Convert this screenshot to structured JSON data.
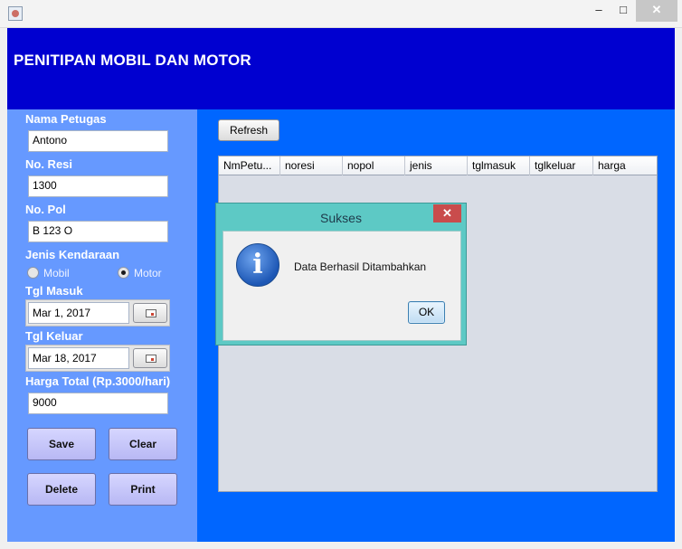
{
  "window": {
    "minimize": "–",
    "maximize": "□",
    "close": "✕"
  },
  "banner": {
    "title": "PENITIPAN MOBIL DAN MOTOR"
  },
  "form": {
    "nama_label": "Nama Petugas",
    "nama_value": "Antono",
    "resi_label": "No. Resi",
    "resi_value": "1300",
    "pol_label": "No. Pol",
    "pol_value": "B 123 O",
    "jenis_label": "Jenis Kendaraan",
    "radio_mobil": "Mobil",
    "radio_motor": "Motor",
    "selected_jenis": "Motor",
    "masuk_label": "Tgl Masuk",
    "masuk_value": "Mar 1, 2017",
    "keluar_label": "Tgl Keluar",
    "keluar_value": "Mar 18, 2017",
    "harga_label": "Harga Total (Rp.3000/hari)",
    "harga_value": "9000"
  },
  "buttons": {
    "save": "Save",
    "clear": "Clear",
    "delete": "Delete",
    "print": "Print",
    "refresh": "Refresh"
  },
  "table": {
    "columns": [
      "NmPetu...",
      "noresi",
      "nopol",
      "jenis",
      "tglmasuk",
      "tglkeluar",
      "harga"
    ],
    "rows": []
  },
  "dialog": {
    "title": "Sukses",
    "message": "Data Berhasil Ditambahkan",
    "ok": "OK",
    "close": "✕"
  },
  "colors": {
    "banner": "#0000d0",
    "form_panel": "#6699ff",
    "right_panel": "#0066ff",
    "dialog_frame": "#5dc9c5"
  },
  "icons": {
    "app": "java-app-icon",
    "calendar": "calendar-icon",
    "info": "info-icon"
  }
}
